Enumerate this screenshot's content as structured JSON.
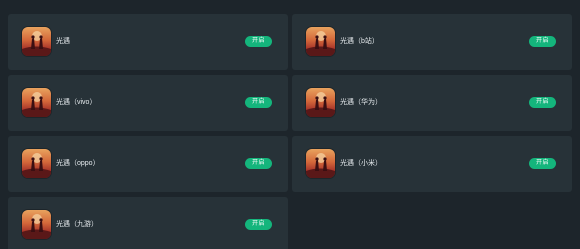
{
  "apps": [
    {
      "name": "光遇",
      "button": "开启"
    },
    {
      "name": "光遇（b站）",
      "button": "开启"
    },
    {
      "name": "光遇（vivo）",
      "button": "开启"
    },
    {
      "name": "光遇（华为）",
      "button": "开启"
    },
    {
      "name": "光遇（oppo）",
      "button": "开启"
    },
    {
      "name": "光遇（小米）",
      "button": "开启"
    },
    {
      "name": "光遇（九游）",
      "button": "开启"
    }
  ],
  "colors": {
    "background": "#1d252b",
    "card": "#273238",
    "button": "#14b57c",
    "text": "#e6ebee"
  },
  "icon": "sky-children-of-light-app-icon"
}
